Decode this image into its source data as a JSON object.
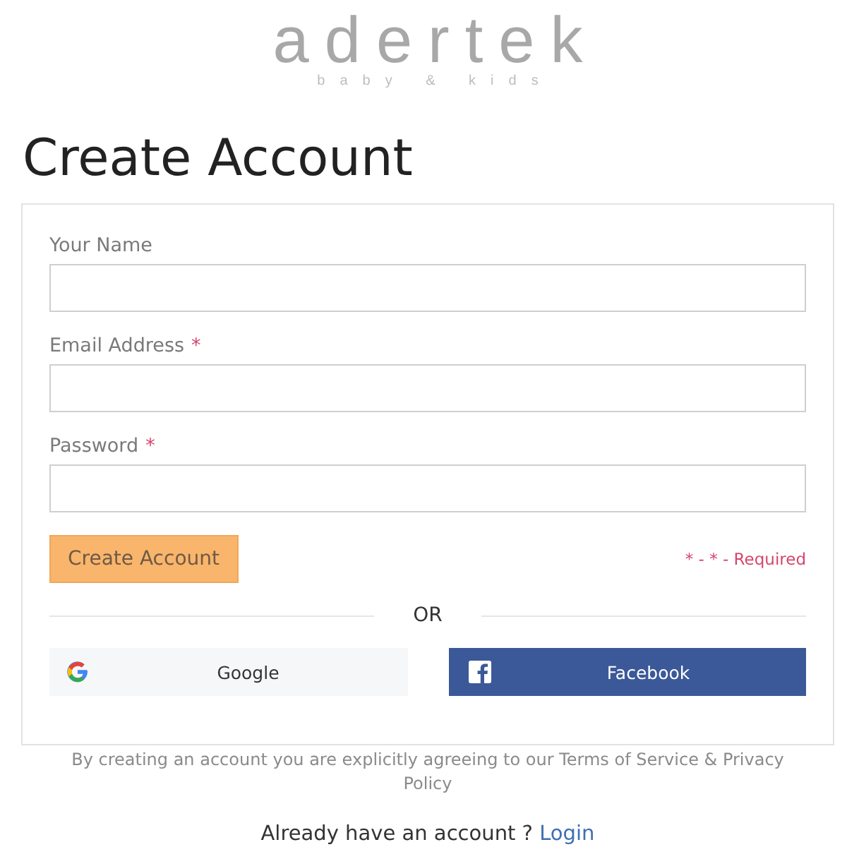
{
  "logo": {
    "name": "adertek",
    "tagline": "baby & kids"
  },
  "heading": "Create Account",
  "form": {
    "fields": [
      {
        "label": "Your Name"
      },
      {
        "label": "Email Address",
        "required_mark": "*"
      },
      {
        "label": "Password",
        "required_mark": "*"
      }
    ],
    "submit": "Create Account",
    "required_note": "* - * - Required",
    "divider": "OR",
    "social": [
      {
        "kind": "google",
        "label": "Google"
      },
      {
        "kind": "facebook",
        "label": "Facebook"
      }
    ]
  },
  "terms": "By creating an account you are explicitly agreeing to our Terms of Service & Privacy Policy",
  "login_prompt": {
    "text": "Already have an account ?",
    "link": "Login"
  }
}
